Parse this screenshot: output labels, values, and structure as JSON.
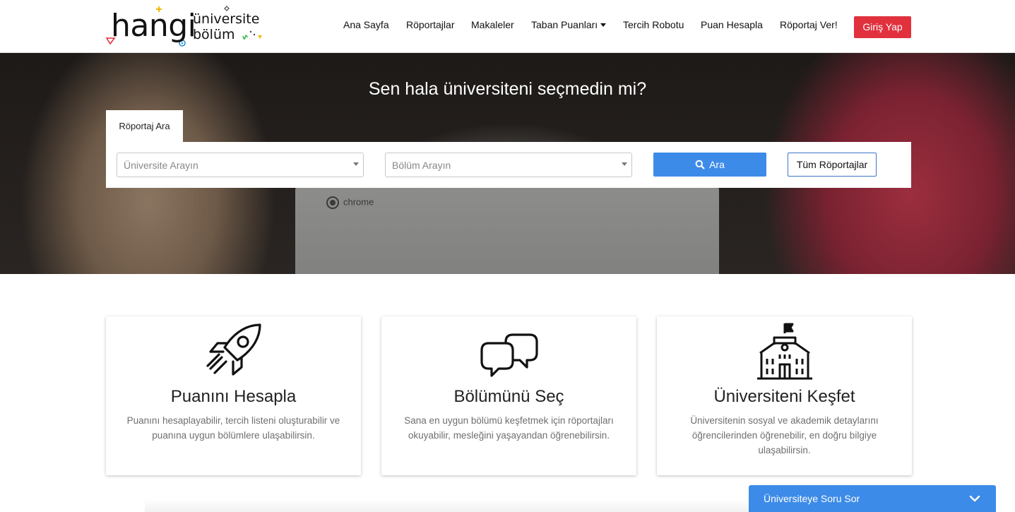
{
  "logo": {
    "word1": "hangi",
    "word2": "üniversite",
    "word3": "bölüm"
  },
  "nav": {
    "items": [
      {
        "label": "Ana Sayfa"
      },
      {
        "label": "Röportajlar"
      },
      {
        "label": "Makaleler"
      },
      {
        "label": "Taban Puanları"
      },
      {
        "label": "Tercih Robotu"
      },
      {
        "label": "Puan Hesapla"
      },
      {
        "label": "Röportaj Ver!"
      }
    ],
    "login_label": "Giriş Yap"
  },
  "hero": {
    "title": "Sen hala üniversiteni seçmedin mi?",
    "chrome_text": "chrome"
  },
  "search": {
    "tab_label": "Röportaj Ara",
    "university_placeholder": "Üniversite Arayın",
    "department_placeholder": "Bölüm Arayın",
    "search_label": "Ara",
    "all_label": "Tüm Röportajlar"
  },
  "cards": [
    {
      "icon": "rocket-icon",
      "title": "Puanını Hesapla",
      "desc": "Puanını hesaplayabilir, tercih listeni oluşturabilir ve puanına uygun bölümlere ulaşabilirsin."
    },
    {
      "icon": "chat-bubbles-icon",
      "title": "Bölümünü Seç",
      "desc": "Sana en uygun bölümü keşfetmek için röportajları okuyabilir, mesleğini yaşayandan öğrenebilirsin."
    },
    {
      "icon": "university-building-icon",
      "title": "Üniversiteni Keşfet",
      "desc": "Üniversitenin sosyal ve akademik detaylarını öğrencilerinden öğrenebilir, en doğru bilgiye ulaşabilirsin."
    }
  ],
  "chat": {
    "label": "Üniversiteye Soru Sor"
  },
  "colors": {
    "accent_blue": "#3d8be8",
    "login_red": "#e0313d",
    "text_dark": "#222222",
    "text_muted": "#6f6f6f"
  }
}
